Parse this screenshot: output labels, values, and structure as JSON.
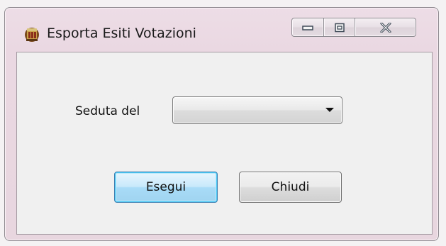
{
  "window": {
    "title": "Esporta Esiti Votazioni",
    "app_icon": "app-icon",
    "caption_buttons": [
      "minimize-icon",
      "maximize-icon",
      "close-icon"
    ]
  },
  "form": {
    "seduta_label": "Seduta del",
    "seduta_value": "",
    "seduta_dropdown_icon": "chevron-down-icon"
  },
  "buttons": {
    "execute_label": "Esegui",
    "close_label": "Chiudi"
  },
  "colors": {
    "frame": "#ead8e2",
    "client_bg": "#f0f0f0",
    "default_button_border": "#3c7fb1",
    "default_button_fill": "#c8e9fb"
  }
}
